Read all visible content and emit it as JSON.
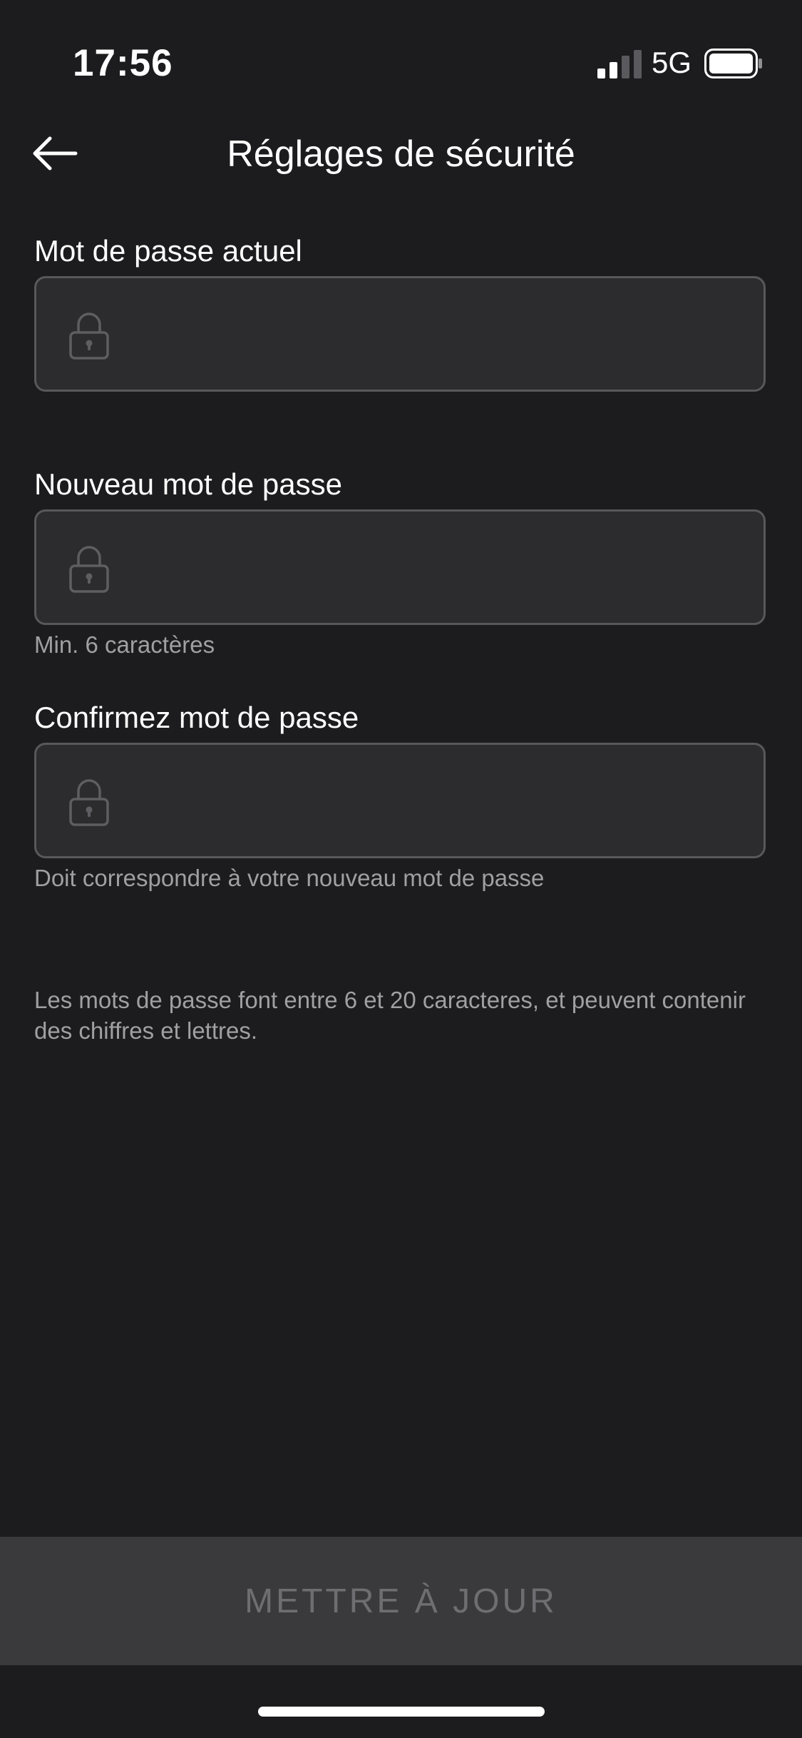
{
  "status_bar": {
    "time": "17:56",
    "network": "5G",
    "icons": [
      "signal-icon",
      "battery-icon"
    ]
  },
  "header": {
    "title": "Réglages de sécurité",
    "back_icon": "arrow-left-icon"
  },
  "fields": [
    {
      "label": "Mot de passe actuel",
      "value": "",
      "icon": "lock-icon",
      "hint": ""
    },
    {
      "label": "Nouveau mot de passe",
      "value": "",
      "icon": "lock-icon",
      "hint": "Min. 6 caractères"
    },
    {
      "label": "Confirmez mot de passe",
      "value": "",
      "icon": "lock-icon",
      "hint": "Doit correspondre à votre nouveau mot de passe"
    }
  ],
  "info": "Les mots de passe font entre 6 et 20 caracteres, et peuvent contenir des chiffres et lettres.",
  "update_button": {
    "label": "METTRE À JOUR",
    "enabled": false
  },
  "colors": {
    "background": "#1c1c1e",
    "field_background": "#2c2c2e",
    "field_border": "#58585c",
    "hint_text": "#a0a0a4",
    "button_background": "#3a3a3c",
    "button_text_disabled": "#6e6e72"
  }
}
